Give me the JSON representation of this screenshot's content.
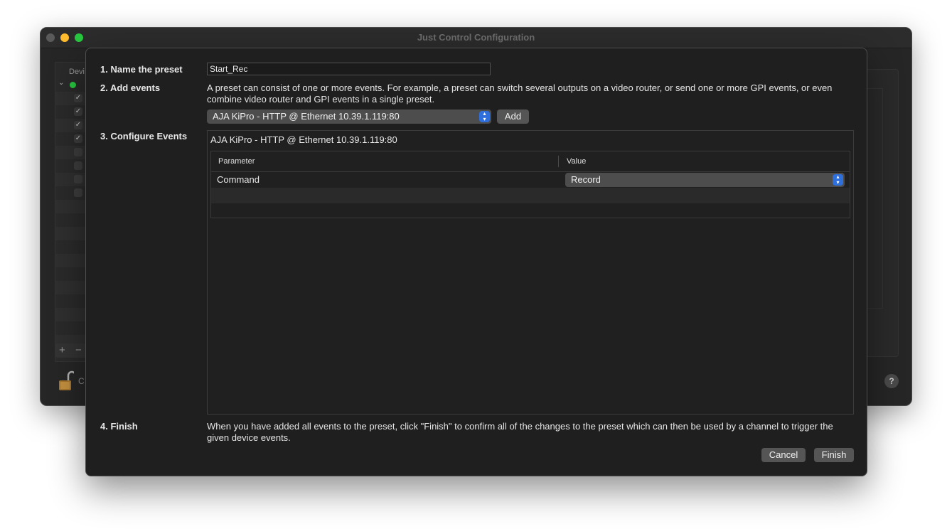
{
  "window": {
    "title": "Just Control Configuration"
  },
  "sidebar": {
    "header": "Devi",
    "lock_label": "C",
    "add_symbol": "+",
    "remove_symbol": "−",
    "check_mark": "✓"
  },
  "sheet": {
    "step1": {
      "label": "1. Name the preset",
      "value": "Start_Rec"
    },
    "step2": {
      "label": "2. Add events",
      "description": "A preset can consist of one or more events. For example, a preset can switch several outputs on a video router, or send one or more GPI events, or even combine video router and GPI events in a single preset.",
      "device_selected": "AJA KiPro - HTTP @ Ethernet 10.39.1.119:80",
      "add_label": "Add"
    },
    "step3": {
      "label": "3. Configure Events",
      "event_title": "AJA KiPro - HTTP @ Ethernet 10.39.1.119:80",
      "columns": [
        "Parameter",
        "Value"
      ],
      "rows": [
        {
          "parameter": "Command",
          "value": "Record"
        }
      ]
    },
    "step4": {
      "label": "4. Finish",
      "description": "When you have added all events to the preset, click \"Finish\" to confirm all of the changes to the preset which can then be used by a channel to trigger the given device events."
    },
    "buttons": {
      "cancel": "Cancel",
      "finish": "Finish"
    }
  },
  "help_label": "?",
  "colors": {
    "accent": "#2f6fdc",
    "sheet_bg": "#1f1f1f",
    "window_bg": "#262626"
  }
}
